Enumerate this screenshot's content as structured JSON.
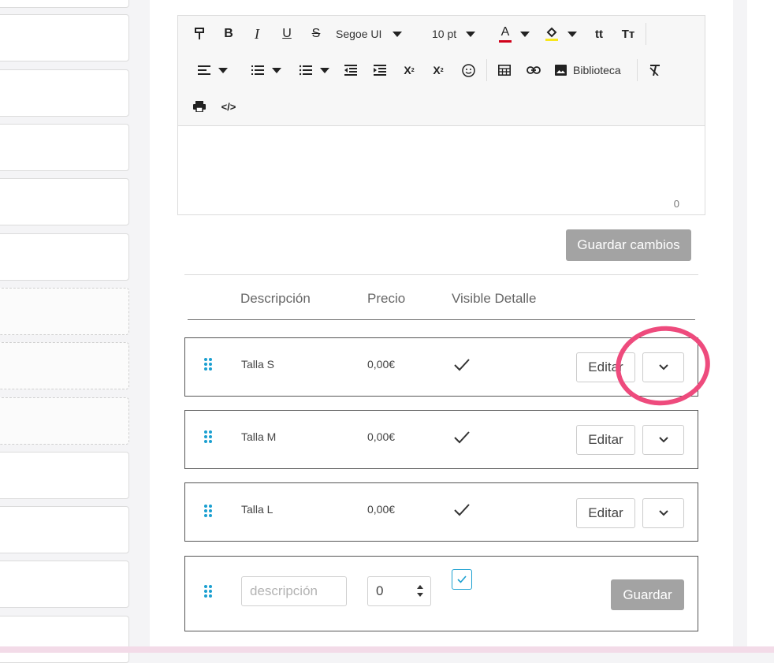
{
  "editor": {
    "font_family": "Segoe UI",
    "font_size": "10 pt",
    "library_label": "Biblioteca",
    "char_count": "0",
    "toolbar_icons": [
      "format-painter-icon",
      "bold-icon",
      "italic-icon",
      "underline-icon",
      "strikethrough-icon",
      "font-color-icon",
      "highlight-color-icon",
      "lowercase-icon",
      "uppercase-icon",
      "align-icon",
      "numbered-list-icon",
      "bullet-list-icon",
      "outdent-icon",
      "indent-icon",
      "superscript-icon",
      "subscript-icon",
      "emoji-icon",
      "table-icon",
      "link-icon",
      "image-icon",
      "clear-format-icon",
      "print-icon",
      "code-icon"
    ],
    "font_color": "#d0021b",
    "highlight_color": "#f8e71c"
  },
  "save_changes_label": "Guardar cambios",
  "table": {
    "headers": [
      "Descripción",
      "Precio",
      "Visible Detalle"
    ],
    "rows": [
      {
        "description": "Talla S",
        "price": "0,00€",
        "visible": true,
        "edit_label": "Editar"
      },
      {
        "description": "Talla M",
        "price": "0,00€",
        "visible": true,
        "edit_label": "Editar"
      },
      {
        "description": "Talla L",
        "price": "0,00€",
        "visible": true,
        "edit_label": "Editar"
      }
    ],
    "new_row": {
      "description_placeholder": "descripción",
      "price_value": "0",
      "save_label": "Guardar"
    }
  },
  "colors": {
    "accent": "#1a9fd0",
    "highlight_circle": "#ee4b7d",
    "button_gray": "#a3a3a3"
  }
}
